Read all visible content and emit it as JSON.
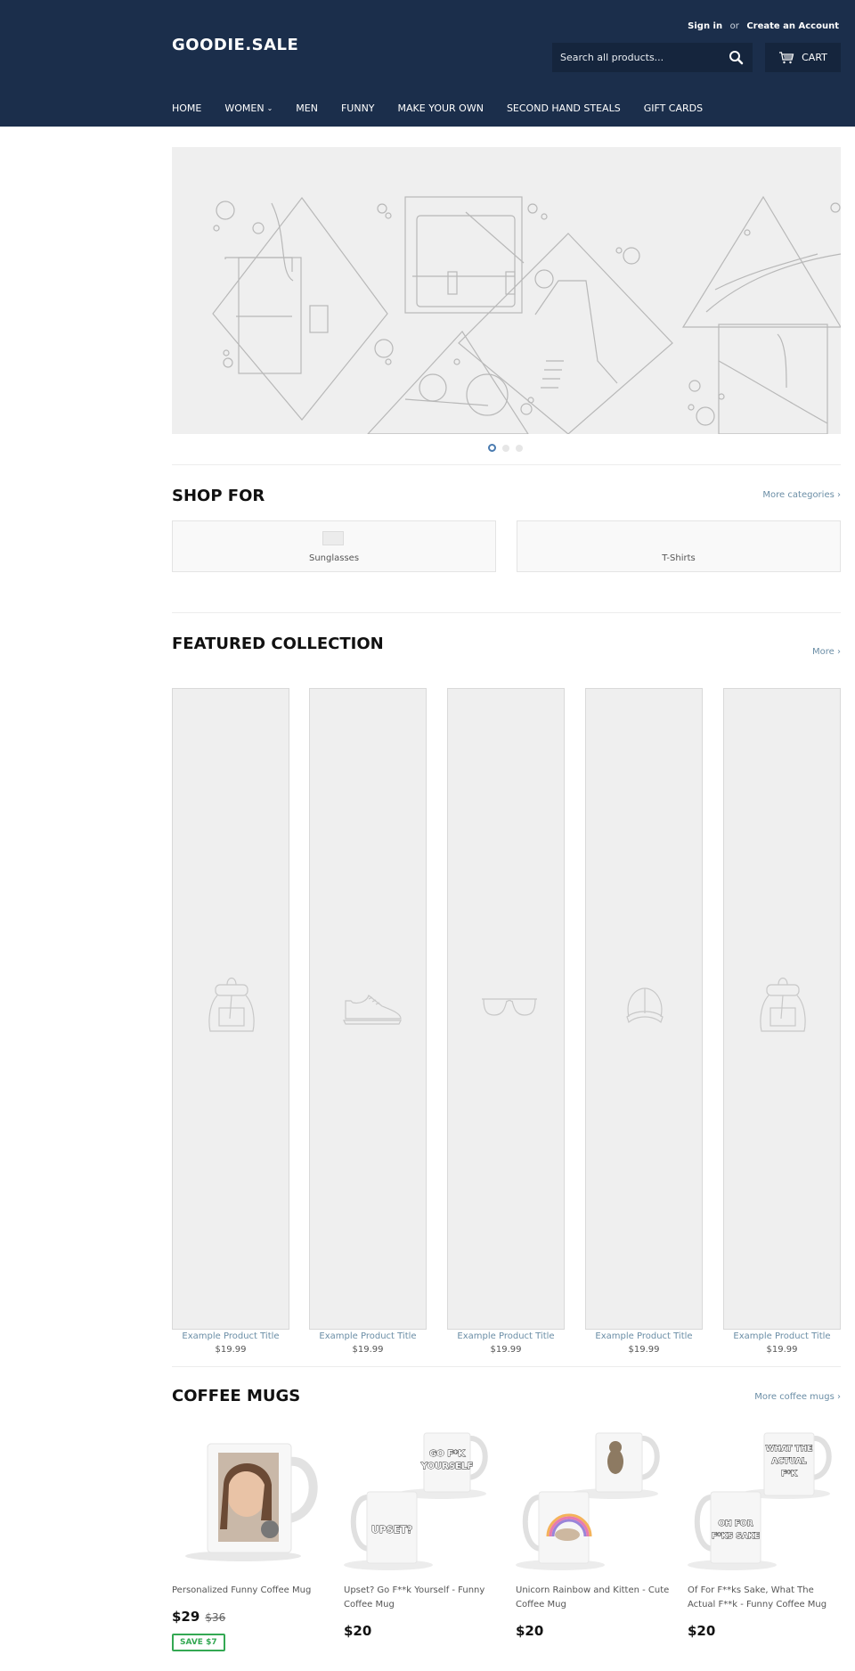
{
  "header": {
    "logo": "GOODIE.SALE",
    "sign_in": "Sign in",
    "or": "or",
    "create_account": "Create an Account",
    "search_placeholder": "Search all products...",
    "search_icon": "search-icon",
    "cart_label": "CART",
    "cart_icon": "cart-icon",
    "nav": [
      {
        "label": "HOME"
      },
      {
        "label": "WOMEN",
        "has_dropdown": true
      },
      {
        "label": "MEN"
      },
      {
        "label": "FUNNY"
      },
      {
        "label": "MAKE YOUR OWN"
      },
      {
        "label": "SECOND HAND STEALS"
      },
      {
        "label": "GIFT CARDS"
      }
    ]
  },
  "hero": {
    "slides": 3,
    "active_slide": 1,
    "illustration": "accessories-line-art-placeholder"
  },
  "shop_for": {
    "title": "SHOP FOR",
    "more_link": "More categories ›",
    "categories": [
      {
        "label": "Sunglasses"
      },
      {
        "label": "T-Shirts"
      }
    ]
  },
  "featured": {
    "title": "FEATURED COLLECTION",
    "more_link": "More ›",
    "products": [
      {
        "title": "Example Product Title",
        "price": "$19.99",
        "icon": "backpack-icon"
      },
      {
        "title": "Example Product Title",
        "price": "$19.99",
        "icon": "sneaker-icon"
      },
      {
        "title": "Example Product Title",
        "price": "$19.99",
        "icon": "glasses-icon"
      },
      {
        "title": "Example Product Title",
        "price": "$19.99",
        "icon": "cap-icon"
      },
      {
        "title": "Example Product Title",
        "price": "$19.99",
        "icon": "backpack-icon"
      }
    ]
  },
  "coffee_mugs": {
    "title": "COFFEE MUGS",
    "more_link": "More coffee mugs ›",
    "products": [
      {
        "title": "Personalized Funny Coffee Mug",
        "price": "$29",
        "compare_price": "$36",
        "badge": "SAVE $7"
      },
      {
        "title": "Upset? Go F**k Yourself - Funny Coffee Mug",
        "price": "$20",
        "mug_texts": [
          "GO F*K YOURSELF",
          "UPSET?"
        ]
      },
      {
        "title": "Unicorn Rainbow and Kitten - Cute Coffee Mug",
        "price": "$20"
      },
      {
        "title": "Of For F**ks Sake, What The Actual F**k - Funny Coffee Mug",
        "price": "$20",
        "mug_texts": [
          "WHAT THE ACTUAL F*K",
          "OH FOR F*KS SAKE"
        ]
      }
    ]
  },
  "colors": {
    "header_bg": "#1b2e4b",
    "search_bg": "#15253d",
    "link": "#6b8ea6",
    "save_badge": "#34a853",
    "dot_active": "#4a7bb0"
  }
}
